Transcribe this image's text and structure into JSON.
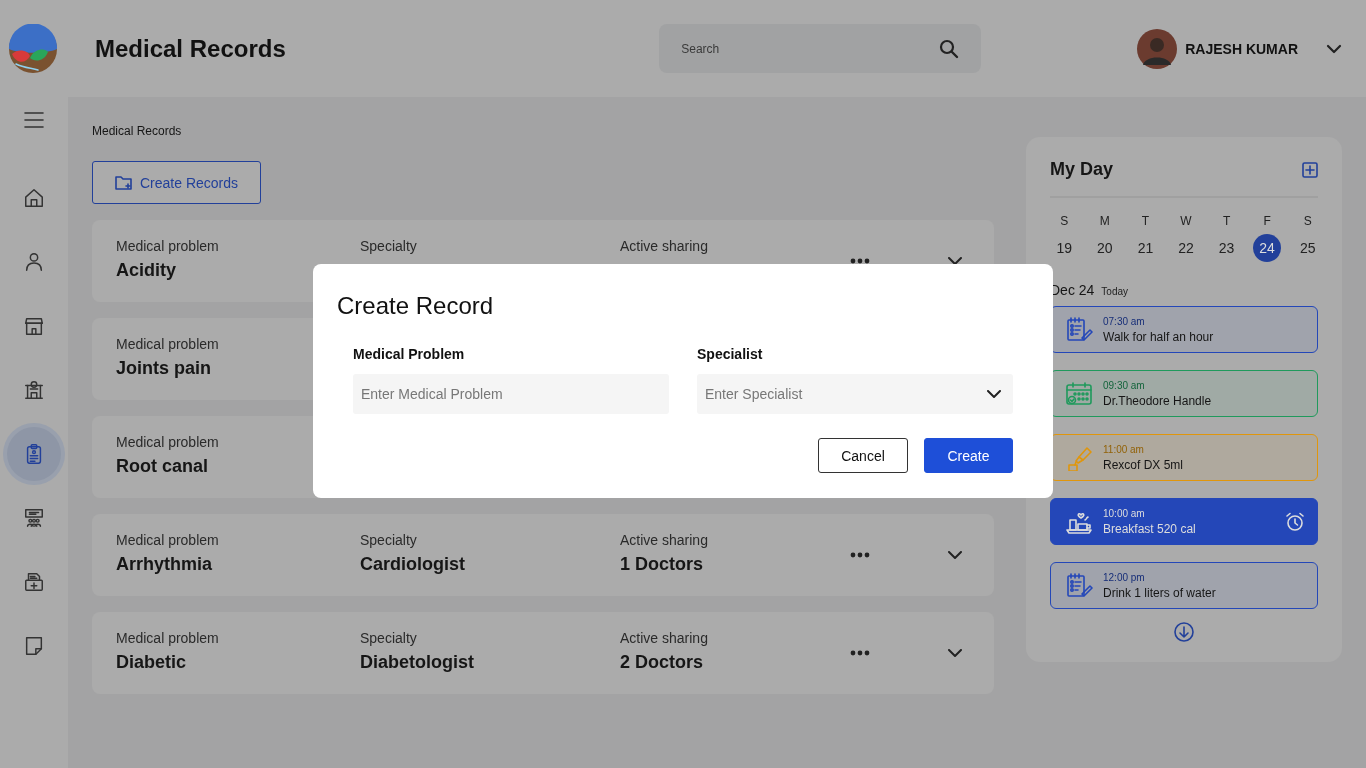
{
  "header": {
    "title": "Medical Records",
    "search": {
      "placeholder": "Search"
    },
    "user": {
      "name": "RAJESH KUMAR"
    }
  },
  "sidebar": {
    "items": [
      {
        "kind": "home",
        "selected": false
      },
      {
        "kind": "user",
        "selected": false
      },
      {
        "kind": "store",
        "selected": false
      },
      {
        "kind": "building",
        "selected": false
      },
      {
        "kind": "clipboard",
        "selected": true
      },
      {
        "kind": "presentation",
        "selected": false
      },
      {
        "kind": "medkit",
        "selected": false
      },
      {
        "kind": "note",
        "selected": false
      }
    ]
  },
  "breadcrumb": "Medical Records",
  "create_button": "Create Records",
  "records": [
    {
      "problem_label": "Medical problem",
      "problem": "Acidity",
      "specialty_label": "Specialty",
      "sharing_label": "Active sharing"
    },
    {
      "problem_label": "Medical problem",
      "problem": "Joints pain"
    },
    {
      "problem_label": "Medical problem",
      "problem": "Root canal"
    },
    {
      "problem_label": "Medical problem",
      "problem": "Arrhythmia",
      "specialty_label": "Specialty",
      "specialty": "Cardiologist",
      "sharing_label": "Active sharing",
      "sharing": "1 Doctors"
    },
    {
      "problem_label": "Medical problem",
      "problem": "Diabetic",
      "specialty_label": "Specialty",
      "specialty": "Diabetologist",
      "sharing_label": "Active sharing",
      "sharing": "2 Doctors"
    }
  ],
  "my_day": {
    "title": "My Day",
    "week": [
      {
        "weekday": "S",
        "day": "19",
        "selected": false
      },
      {
        "weekday": "M",
        "day": "20",
        "selected": false
      },
      {
        "weekday": "T",
        "day": "21",
        "selected": false
      },
      {
        "weekday": "W",
        "day": "22",
        "selected": false
      },
      {
        "weekday": "T",
        "day": "23",
        "selected": false
      },
      {
        "weekday": "F",
        "day": "24",
        "selected": true
      },
      {
        "weekday": "S",
        "day": "25",
        "selected": false
      }
    ],
    "date": "Dec 24",
    "date_note": "Today",
    "events": [
      {
        "kind": "checklist",
        "color": "#2447b8",
        "time": "07:30 am",
        "title": "Walk for half an hour",
        "highlighted": false,
        "alarm": false
      },
      {
        "kind": "calendar",
        "color": "#1f9a5c",
        "time": "09:30 am",
        "title": "Dr.Theodore Handle",
        "highlighted": false,
        "alarm": false
      },
      {
        "kind": "medicine",
        "color": "#e0960c",
        "time": "11:00 am",
        "title": "Rexcof DX 5ml",
        "highlighted": false,
        "alarm": false
      },
      {
        "kind": "meal",
        "color": "#2447b8",
        "time": "10:00 am",
        "title": "Breakfast 520 cal",
        "highlighted": true,
        "alarm": true
      },
      {
        "kind": "checklist",
        "color": "#2447b8",
        "time": "12:00 pm",
        "title": "Drink 1 liters of water",
        "highlighted": false,
        "alarm": false
      }
    ]
  },
  "dialog": {
    "title": "Create Record",
    "fields": [
      {
        "kind": "text",
        "label": "Medical Problem",
        "placeholder": "Enter Medical Problem"
      },
      {
        "kind": "select",
        "label": "Specialist",
        "placeholder": "Enter Specialist"
      }
    ],
    "buttons": [
      {
        "kind": "secondary",
        "label": "Cancel"
      },
      {
        "kind": "primary",
        "label": "Create"
      }
    ]
  }
}
